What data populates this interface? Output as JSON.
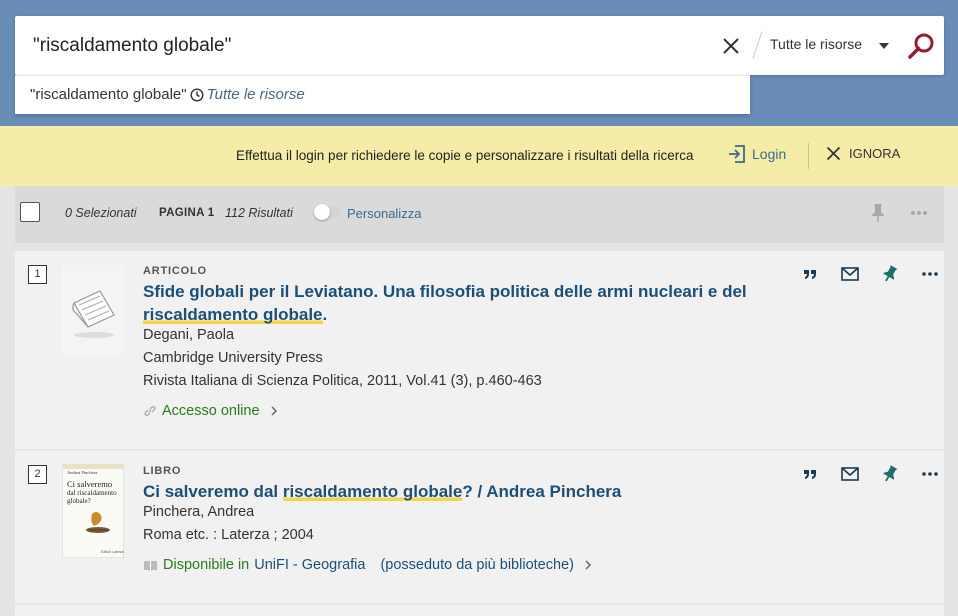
{
  "search": {
    "query": "\"riscaldamento globale\"",
    "scope": "Tutte le risorse"
  },
  "suggestion": {
    "term": "\"riscaldamento globale\"",
    "scope": "Tutte le risorse"
  },
  "login_bar": {
    "message": "Effettua il login per richiedere le copie e personalizzare i risultati della ricerca",
    "login_label": "Login",
    "ignore_label": "IGNORA"
  },
  "toolbar": {
    "selected": "0 Selezionati",
    "page": "PAGINA 1",
    "results": "112 Risultati",
    "personalize": "Personalizza"
  },
  "results": [
    {
      "num": "1",
      "type": "ARTICOLO",
      "title_pre": "Sfide globali per il Leviatano. Una filosofia politica delle armi nucleari e del ",
      "title_hl": "riscaldamento globale",
      "title_post": ".",
      "author": "Degani, Paola",
      "publisher": "Cambridge University Press",
      "source": "Rivista Italiana di Scienza Politica, 2011, Vol.41 (3), p.460-463",
      "availability": "Accesso online"
    },
    {
      "num": "2",
      "type": "LIBRO",
      "title_pre": "Ci salveremo dal ",
      "title_hl": "riscaldamento globale",
      "title_post": "? / Andrea Pinchera",
      "author": "Pinchera, Andrea",
      "publisher": "Roma etc. : Laterza ; 2004",
      "availability": "Disponibile in",
      "location": "UniFI - Geografia",
      "more": "(posseduto da più biblioteche)",
      "cover": {
        "author": "Andrea Pinchera",
        "title_l1": "Ci salveremo",
        "title_l2": "dal riscaldamento",
        "title_l3": "globale?",
        "publisher": "Editori Laterza"
      }
    }
  ],
  "colors": {
    "header": "#6a8db7",
    "login_bar": "#f5eca8",
    "link": "#1b4f79",
    "available": "#2b7a1e",
    "highlight": "#f2d54a",
    "search_icon": "#9b1b30",
    "pin": "#1f6f6a"
  },
  "icons": [
    "clear-icon",
    "search-icon",
    "clock-icon",
    "login-icon",
    "close-icon",
    "pin-icon",
    "more-icon",
    "quote-icon",
    "email-icon",
    "link-icon",
    "book-icon",
    "chevron-right-icon"
  ]
}
